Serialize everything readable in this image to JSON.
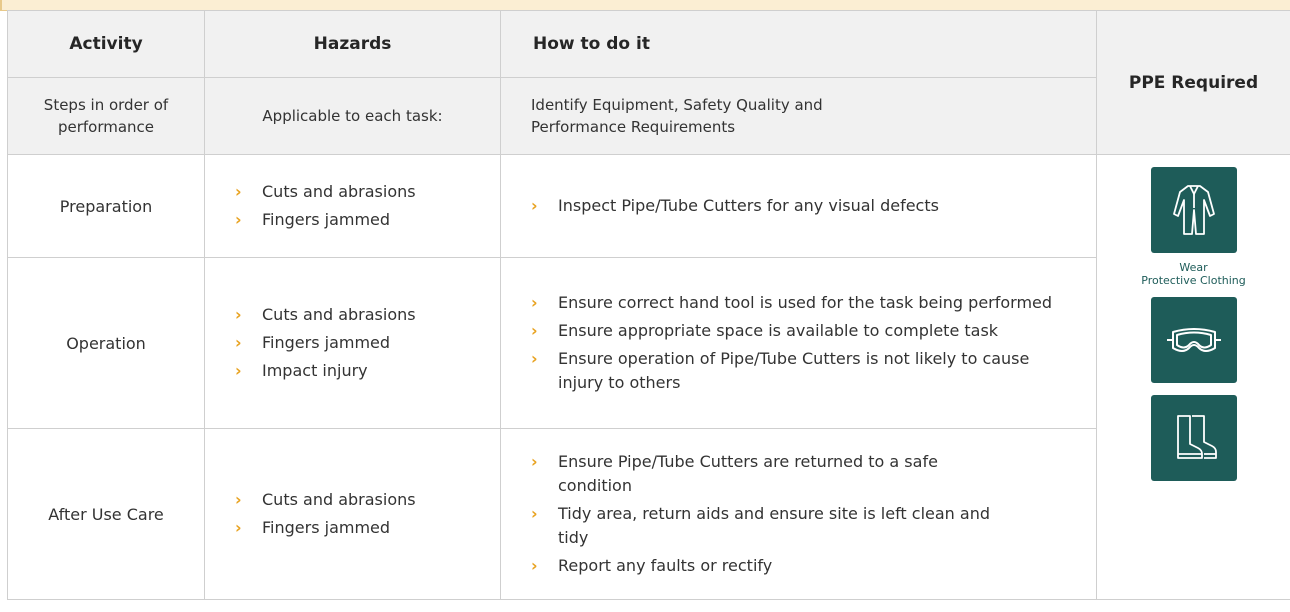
{
  "headers": {
    "activity": "Activity",
    "hazards": "Hazards",
    "how": "How to do it",
    "ppe": "PPE Required"
  },
  "subheaders": {
    "activity": "Steps in order of performance",
    "hazards": "Applicable to each task:",
    "how": "Identify Equipment, Safety Quality and Performance Requirements"
  },
  "rows": [
    {
      "activity": "Preparation",
      "hazards": [
        "Cuts and abrasions",
        "Fingers jammed"
      ],
      "how": [
        "Inspect Pipe/Tube Cutters for any visual defects"
      ]
    },
    {
      "activity": "Operation",
      "hazards": [
        "Cuts and abrasions",
        "Fingers jammed",
        "Impact injury"
      ],
      "how": [
        "Ensure correct hand tool is used for the task being performed",
        "Ensure appropriate space is available to complete task",
        "Ensure operation of Pipe/Tube Cutters is not likely to cause injury to others"
      ]
    },
    {
      "activity": "After Use Care",
      "hazards": [
        "Cuts and abrasions",
        "Fingers jammed"
      ],
      "how": [
        "Ensure Pipe/Tube Cutters are returned to a safe condition",
        "Tidy area, return aids and ensure site is left clean and tidy",
        "Report any faults or rectify"
      ]
    }
  ],
  "ppe": {
    "caption_line1": "Wear",
    "caption_line2": "Protective Clothing",
    "icons": [
      "coverall-icon",
      "goggles-icon",
      "boots-icon"
    ]
  },
  "colors": {
    "bullet": "#e8a21f",
    "ppe_tile": "#1e5c59",
    "header_bg": "#f1f1f1",
    "top_band": "#fbeed3"
  }
}
